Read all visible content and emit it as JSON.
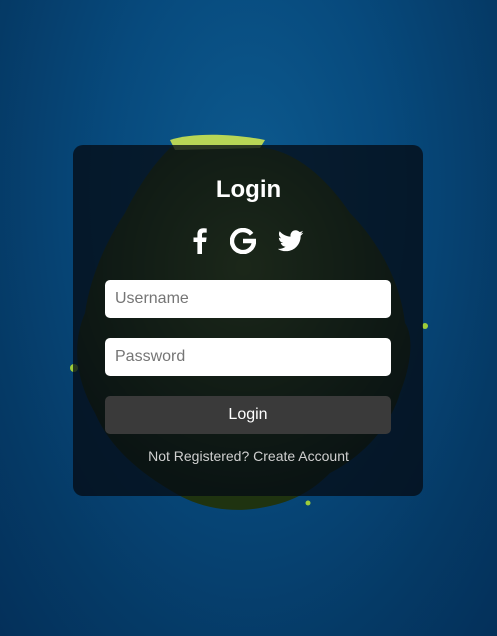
{
  "login": {
    "title": "Login",
    "social": [
      {
        "icon": "facebook-icon"
      },
      {
        "icon": "google-icon"
      },
      {
        "icon": "twitter-icon"
      }
    ],
    "username_placeholder": "Username",
    "password_placeholder": "Password",
    "button_label": "Login",
    "footer_text": "Not Registered?",
    "footer_link": "Create Account"
  },
  "colors": {
    "background": "#074a7d",
    "card": "#050c14",
    "button": "#3a3a3a",
    "text": "#ffffff"
  }
}
